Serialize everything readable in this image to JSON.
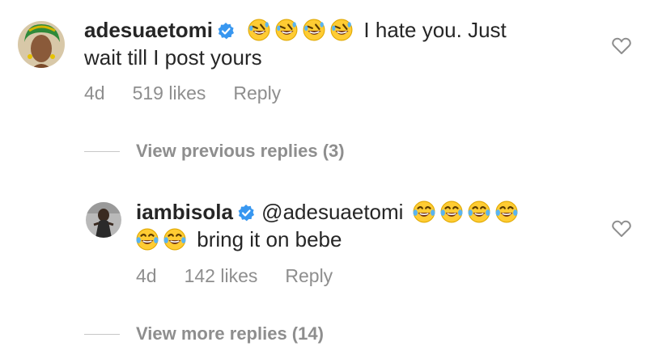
{
  "comments": [
    {
      "username": "adesuaetomi",
      "lead_emoji": [
        "rofl-emoji",
        "rofl-emoji",
        "rofl-emoji",
        "rofl-emoji"
      ],
      "text_line1": "I hate you. Just",
      "text_line2": "wait till I post yours",
      "time": "4d",
      "likes": "519 likes",
      "reply_label": "Reply"
    },
    {
      "username": "iambisola",
      "mention": "@adesuaetomi",
      "lead_emoji": [
        "joy-emoji",
        "joy-emoji",
        "joy-emoji",
        "joy-emoji"
      ],
      "line2_emoji": [
        "joy-emoji",
        "joy-emoji"
      ],
      "text_line2": "bring it on bebe",
      "time": "4d",
      "likes": "142 likes",
      "reply_label": "Reply"
    }
  ],
  "toggles": {
    "previous": "View previous replies (3)",
    "more": "View more replies (14)"
  },
  "colors": {
    "text": "#262626",
    "muted": "#8e8e8e",
    "verified_blue": "#3897f0",
    "divider": "#c7c7c7"
  },
  "icons": {
    "verified": "verified-badge-icon",
    "heart": "heart-outline-icon"
  }
}
